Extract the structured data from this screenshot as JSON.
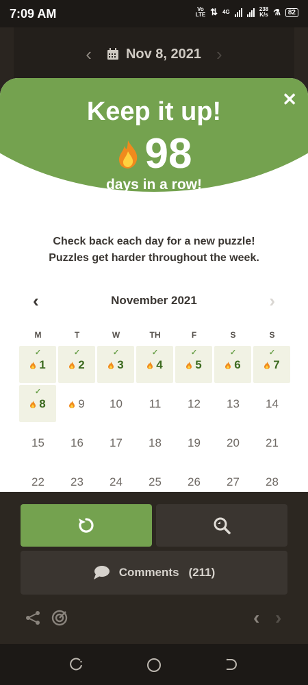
{
  "status_bar": {
    "time": "7:09 AM",
    "network_label_top": "Vo",
    "network_label_bottom": "LTE",
    "network_type": "4G",
    "speed_value": "238",
    "speed_unit": "K/s",
    "battery": "82"
  },
  "date_nav": {
    "date": "Nov 8, 2021",
    "prev_icon": "chevron-left-icon",
    "next_icon": "chevron-right-icon",
    "calendar_icon": "calendar-icon"
  },
  "modal": {
    "headline": "Keep it up!",
    "streak_count": "98",
    "streak_label": "days in a row!",
    "message_line1": "Check back each day for a new puzzle!",
    "message_line2": "Puzzles get harder throughout the week.",
    "close_icon": "close-icon",
    "accent_color": "#74a24f"
  },
  "calendar": {
    "month_label": "November 2021",
    "weekdays": [
      "M",
      "T",
      "W",
      "TH",
      "F",
      "S",
      "S"
    ],
    "days": [
      {
        "n": "1",
        "state": "done"
      },
      {
        "n": "2",
        "state": "done"
      },
      {
        "n": "3",
        "state": "done"
      },
      {
        "n": "4",
        "state": "done"
      },
      {
        "n": "5",
        "state": "done"
      },
      {
        "n": "6",
        "state": "done"
      },
      {
        "n": "7",
        "state": "done"
      },
      {
        "n": "8",
        "state": "done"
      },
      {
        "n": "9",
        "state": "streak"
      },
      {
        "n": "10",
        "state": "none"
      },
      {
        "n": "11",
        "state": "none"
      },
      {
        "n": "12",
        "state": "none"
      },
      {
        "n": "13",
        "state": "none"
      },
      {
        "n": "14",
        "state": "none"
      },
      {
        "n": "15",
        "state": "none"
      },
      {
        "n": "16",
        "state": "none"
      },
      {
        "n": "17",
        "state": "none"
      },
      {
        "n": "18",
        "state": "none"
      },
      {
        "n": "19",
        "state": "none"
      },
      {
        "n": "20",
        "state": "none"
      },
      {
        "n": "21",
        "state": "none"
      },
      {
        "n": "22",
        "state": "none"
      },
      {
        "n": "23",
        "state": "none"
      },
      {
        "n": "24",
        "state": "none"
      },
      {
        "n": "25",
        "state": "none"
      },
      {
        "n": "26",
        "state": "none"
      },
      {
        "n": "27",
        "state": "none"
      },
      {
        "n": "28",
        "state": "none"
      }
    ]
  },
  "actions": {
    "restart_icon": "restart-icon",
    "reveal_icon": "magnifier-icon",
    "comments_label": "Comments",
    "comments_count": "(211)",
    "comments_icon": "speech-bubble-icon"
  },
  "toolbar": {
    "share_icon": "share-icon",
    "target_icon": "target-icon",
    "prev_icon": "chevron-left-icon",
    "next_icon": "chevron-right-icon"
  },
  "nav_bar": {
    "recents_icon": "recents-icon",
    "home_icon": "home-icon",
    "back_icon": "back-icon"
  }
}
